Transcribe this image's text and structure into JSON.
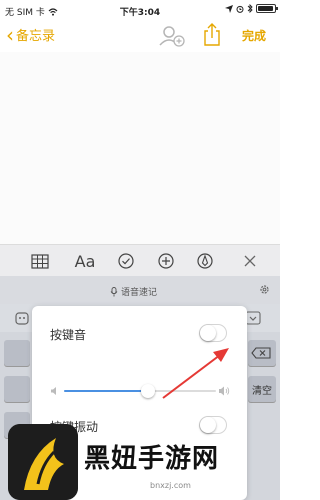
{
  "status_bar": {
    "carrier": "无 SIM 卡",
    "time": "下午3:04",
    "battery": ""
  },
  "nav": {
    "back_label": "备忘录",
    "done_label": "完成"
  },
  "voice_input": {
    "label": "语音速记"
  },
  "panel": {
    "key_sound_label": "按键音",
    "key_sound_on": false,
    "volume_level": 0.55,
    "vibration_label": "按键振动",
    "vibration_on": false
  },
  "keyboard": {
    "clear_label": "清空"
  },
  "watermark": {
    "title": "黑妞手游网",
    "url": "bnxzj.com"
  },
  "colors": {
    "accent": "#e5a700",
    "slider_fill": "#4a90e2",
    "annotation_arrow": "#e53935"
  }
}
